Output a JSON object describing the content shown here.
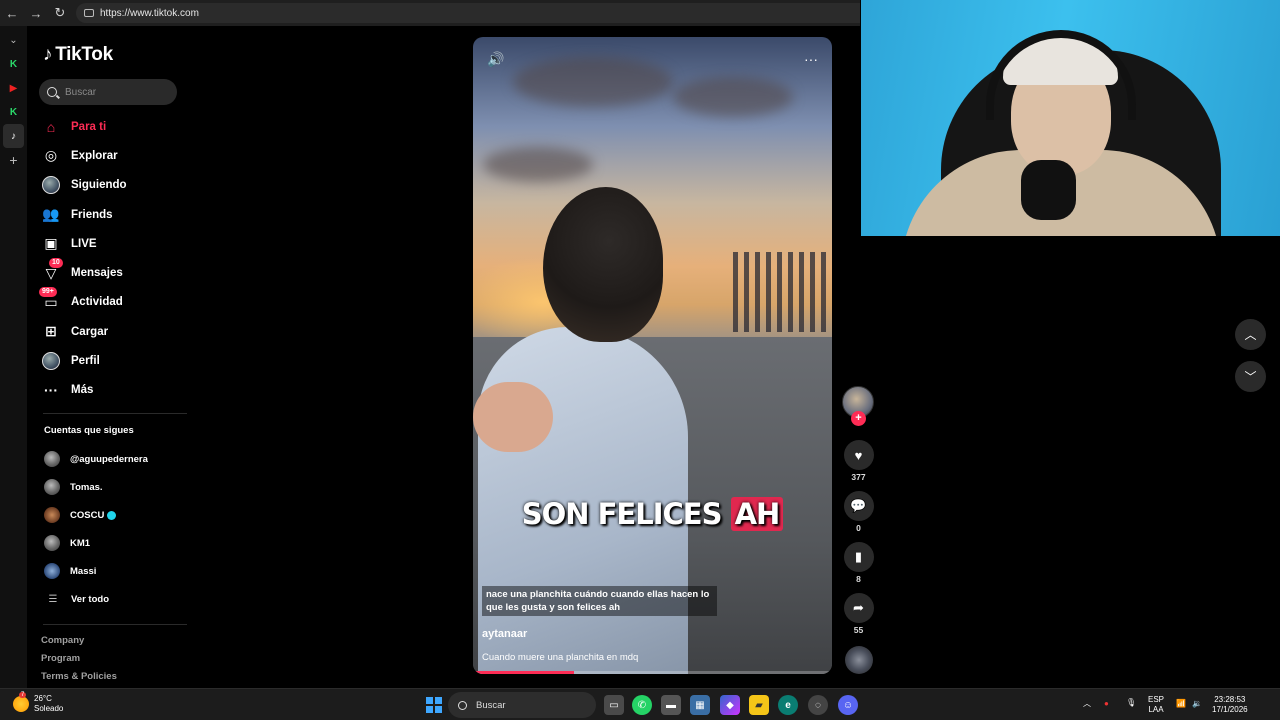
{
  "browser": {
    "url": "https://www.tiktok.com",
    "back_icon": "back-arrow-icon",
    "forward_icon": "forward-arrow-icon",
    "reload_icon": "reload-icon"
  },
  "tiktok": {
    "logo_text": "TikTok",
    "search_placeholder": "Buscar",
    "nav": [
      {
        "label": "Para ti",
        "icon": "home-icon",
        "active": true
      },
      {
        "label": "Explorar",
        "icon": "compass-icon"
      },
      {
        "label": "Siguiendo",
        "icon": "following-avatar-icon"
      },
      {
        "label": "Friends",
        "icon": "friends-icon"
      },
      {
        "label": "LIVE",
        "icon": "live-tv-icon"
      },
      {
        "label": "Mensajes",
        "icon": "messages-icon",
        "badge": "10"
      },
      {
        "label": "Actividad",
        "icon": "activity-icon",
        "badge": "99+"
      },
      {
        "label": "Cargar",
        "icon": "upload-icon"
      },
      {
        "label": "Perfil",
        "icon": "profile-avatar-icon"
      },
      {
        "label": "Más",
        "icon": "more-dots-icon"
      }
    ],
    "following_title": "Cuentas que sigues",
    "following": [
      {
        "name": "@aguupedernera"
      },
      {
        "name": "Tomas."
      },
      {
        "name": "COSCU",
        "verified": true
      },
      {
        "name": "KM1"
      },
      {
        "name": "Massi"
      }
    ],
    "see_all": "Ver todo",
    "footer": [
      "Company",
      "Program",
      "Terms & Policies"
    ]
  },
  "video": {
    "overlay_text_plain": "SON FELICES",
    "overlay_text_highlight": "AH",
    "subtitle": "nace una planchita cuándo cuando ellas hacen lo que les gusta y son felices ah",
    "author": "aytanaar",
    "description": "Cuando muere una planchita en mdq",
    "progress_percent": 28,
    "likes": "377",
    "comments": "0",
    "saves": "8",
    "shares": "55",
    "follow_plus": "+"
  },
  "taskbar": {
    "temperature": "26°C",
    "weather": "Soleado",
    "weather_badge": "7",
    "search": "Buscar",
    "lang1": "ESP",
    "lang2": "LAA",
    "time": "23:28:53",
    "date": "17/1/2026"
  },
  "colors": {
    "accent": "#fe2c55",
    "verified": "#20d5ec",
    "taskbar": "#1c1c1c"
  }
}
